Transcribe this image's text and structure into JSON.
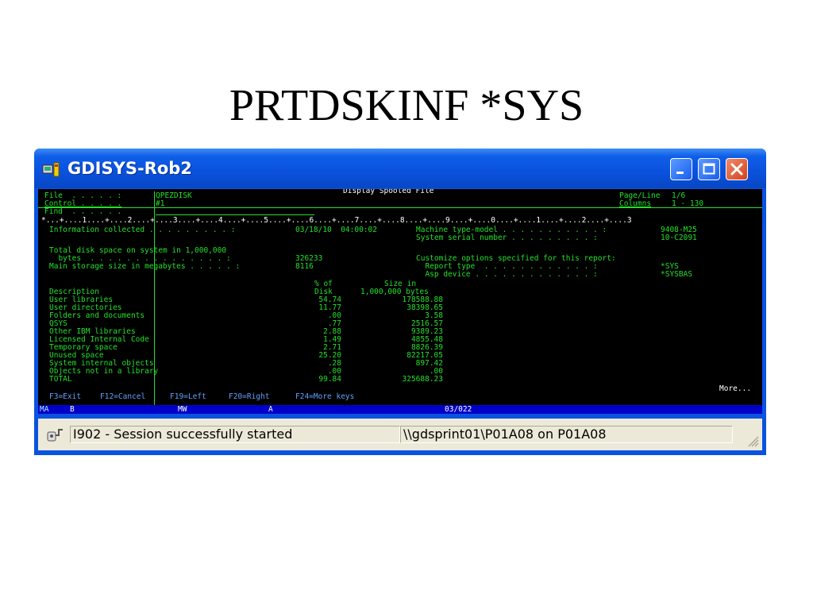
{
  "slide": {
    "title": "PRTDSKINF *SYS"
  },
  "window": {
    "title": "GDISYS-Rob2",
    "buttons": {
      "minimize": "minimize",
      "maximize": "maximize",
      "close": "close"
    }
  },
  "terminal": {
    "header": {
      "file_label": "File  . . . . . :",
      "file_value": "QPEZDISK",
      "control_label": "Control . . . . .",
      "control_value": "#1",
      "find_label": "Find  . . . . . .",
      "center_title": "Display Spooled File",
      "pageline_label": "Page/Line",
      "pageline_value": "1/6",
      "columns_label": "Columns",
      "columns_value": "1 - 130"
    },
    "ruler": "*...+....1....+....2....+....3....+....4....+....5....+....6....+....7....+....8....+....9....+....0....+....1....+....2....+....3",
    "info": {
      "collected_label": "Information collected . . . . . . . . . :",
      "collected_value": "03/18/10  04:00:02",
      "machine_label": "Machine type-model . . . . . . . . . . . :",
      "machine_value": "9408-M25",
      "serial_label": "System serial number . . . . . . . . . :",
      "serial_value": "10-C2091",
      "total_label_1": "Total disk space on system in 1,000,000",
      "total_label_2": "  bytes  . . . . . . . . . . . . . . . :",
      "total_value": "326233",
      "main_label": "Main storage size in megabytes . . . . . :",
      "main_value": "8116",
      "customize_label": "Customize options specified for this report:",
      "report_type_label": "  Report type  . . . . . . . . . . . . :",
      "report_type_value": "*SYS",
      "asp_label": "  Asp device . . . . . . . . . . . . . :",
      "asp_value": "*SYSBAS"
    },
    "table": {
      "col1_header_top": "% of",
      "col1_header": "Disk",
      "col2_header_top": "Size in",
      "col2_header": "1,000,000 bytes",
      "desc_header": "Description",
      "rows": [
        {
          "desc": "User libraries",
          "pct": "54.74",
          "size": "178588.88"
        },
        {
          "desc": "User directories",
          "pct": "11.77",
          "size": "38398.65"
        },
        {
          "desc": "Folders and documents",
          "pct": ".00",
          "size": "3.58"
        },
        {
          "desc": "QSYS",
          "pct": ".77",
          "size": "2516.57"
        },
        {
          "desc": "Other IBM libraries",
          "pct": "2.88",
          "size": "9389.23"
        },
        {
          "desc": "Licensed Internal Code",
          "pct": "1.49",
          "size": "4855.48"
        },
        {
          "desc": "Temporary space",
          "pct": "2.71",
          "size": "8826.39"
        },
        {
          "desc": "Unused space",
          "pct": "25.20",
          "size": "82217.05"
        },
        {
          "desc": "System internal objects",
          "pct": ".28",
          "size": "897.42"
        },
        {
          "desc": "Objects not in a library",
          "pct": ".00",
          "size": ".00"
        },
        {
          "desc": "TOTAL",
          "pct": "99.84",
          "size": "325688.23"
        }
      ]
    },
    "more": "More...",
    "fkeys": [
      {
        "label": "F3=Exit"
      },
      {
        "label": "F12=Cancel"
      },
      {
        "label": "F19=Left"
      },
      {
        "label": "F20=Right"
      },
      {
        "label": "F24=More keys"
      }
    ],
    "status": {
      "ma": "MA",
      "b": "B",
      "mw": "MW",
      "a": "A",
      "pos": "03/022"
    }
  },
  "statusbar": {
    "message": "I902 - Session successfully started",
    "printer": "\\\\gdsprint01\\P01A08 on P01A08"
  },
  "colors": {
    "terminal_green": "#22e02a",
    "xp_blue": "#0a53e0",
    "status_blue": "#0000c8"
  }
}
